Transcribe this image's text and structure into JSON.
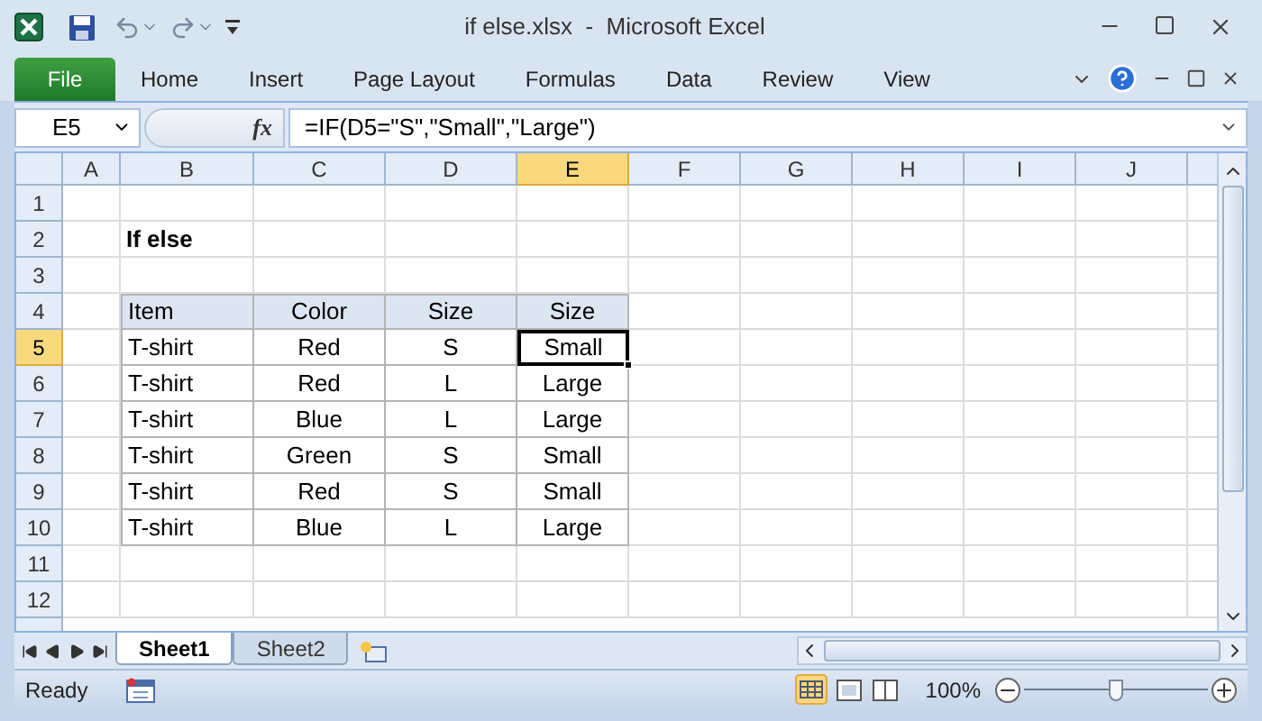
{
  "window": {
    "title": "if else.xlsx  -  Microsoft Excel"
  },
  "ribbon_tabs": [
    {
      "label": "File",
      "kind": "file",
      "selected": false
    },
    {
      "label": "Home",
      "kind": "tab",
      "selected": false
    },
    {
      "label": "Insert",
      "kind": "tab",
      "selected": false
    },
    {
      "label": "Page Layout",
      "kind": "tab",
      "selected": false
    },
    {
      "label": "Formulas",
      "kind": "tab",
      "selected": false
    },
    {
      "label": "Data",
      "kind": "tab",
      "selected": false
    },
    {
      "label": "Review",
      "kind": "tab",
      "selected": false
    },
    {
      "label": "View",
      "kind": "tab",
      "selected": false
    }
  ],
  "formula_bar": {
    "name_box": "E5",
    "fx": "fx",
    "formula": "=IF(D5=\"S\",\"Small\",\"Large\")"
  },
  "columns": [
    {
      "label": "A",
      "selected": false
    },
    {
      "label": "B",
      "selected": false
    },
    {
      "label": "C",
      "selected": false
    },
    {
      "label": "D",
      "selected": false
    },
    {
      "label": "E",
      "selected": true
    },
    {
      "label": "F",
      "selected": false
    },
    {
      "label": "G",
      "selected": false
    },
    {
      "label": "H",
      "selected": false
    },
    {
      "label": "I",
      "selected": false
    },
    {
      "label": "J",
      "selected": false
    }
  ],
  "rows": [
    {
      "label": "1",
      "selected": false
    },
    {
      "label": "2",
      "selected": false
    },
    {
      "label": "3",
      "selected": false
    },
    {
      "label": "4",
      "selected": false
    },
    {
      "label": "5",
      "selected": true
    },
    {
      "label": "6",
      "selected": false
    },
    {
      "label": "7",
      "selected": false
    },
    {
      "label": "8",
      "selected": false
    },
    {
      "label": "9",
      "selected": false
    },
    {
      "label": "10",
      "selected": false
    },
    {
      "label": "11",
      "selected": false
    },
    {
      "label": "12",
      "selected": false
    }
  ],
  "sheet_title": "If else",
  "table": {
    "headers": [
      "Item",
      "Color",
      "Size",
      "Size"
    ],
    "rows": [
      {
        "cells": [
          {
            "text": "T-shirt",
            "selected": false
          },
          {
            "text": "Red",
            "selected": false
          },
          {
            "text": "S",
            "selected": false
          },
          {
            "text": "Small",
            "selected": true
          }
        ]
      },
      {
        "cells": [
          {
            "text": "T-shirt",
            "selected": false
          },
          {
            "text": "Red",
            "selected": false
          },
          {
            "text": "L",
            "selected": false
          },
          {
            "text": "Large",
            "selected": false
          }
        ]
      },
      {
        "cells": [
          {
            "text": "T-shirt",
            "selected": false
          },
          {
            "text": "Blue",
            "selected": false
          },
          {
            "text": "L",
            "selected": false
          },
          {
            "text": "Large",
            "selected": false
          }
        ]
      },
      {
        "cells": [
          {
            "text": "T-shirt",
            "selected": false
          },
          {
            "text": "Green",
            "selected": false
          },
          {
            "text": "S",
            "selected": false
          },
          {
            "text": "Small",
            "selected": false
          }
        ]
      },
      {
        "cells": [
          {
            "text": "T-shirt",
            "selected": false
          },
          {
            "text": "Red",
            "selected": false
          },
          {
            "text": "S",
            "selected": false
          },
          {
            "text": "Small",
            "selected": false
          }
        ]
      },
      {
        "cells": [
          {
            "text": "T-shirt",
            "selected": false
          },
          {
            "text": "Blue",
            "selected": false
          },
          {
            "text": "L",
            "selected": false
          },
          {
            "text": "Large",
            "selected": false
          }
        ]
      }
    ]
  },
  "sheet_tabs": [
    {
      "label": "Sheet1",
      "selected": true
    },
    {
      "label": "Sheet2",
      "selected": false
    }
  ],
  "status_bar": {
    "status": "Ready",
    "zoom": "100%",
    "zoom_level": {
      "level": 0.5
    }
  }
}
